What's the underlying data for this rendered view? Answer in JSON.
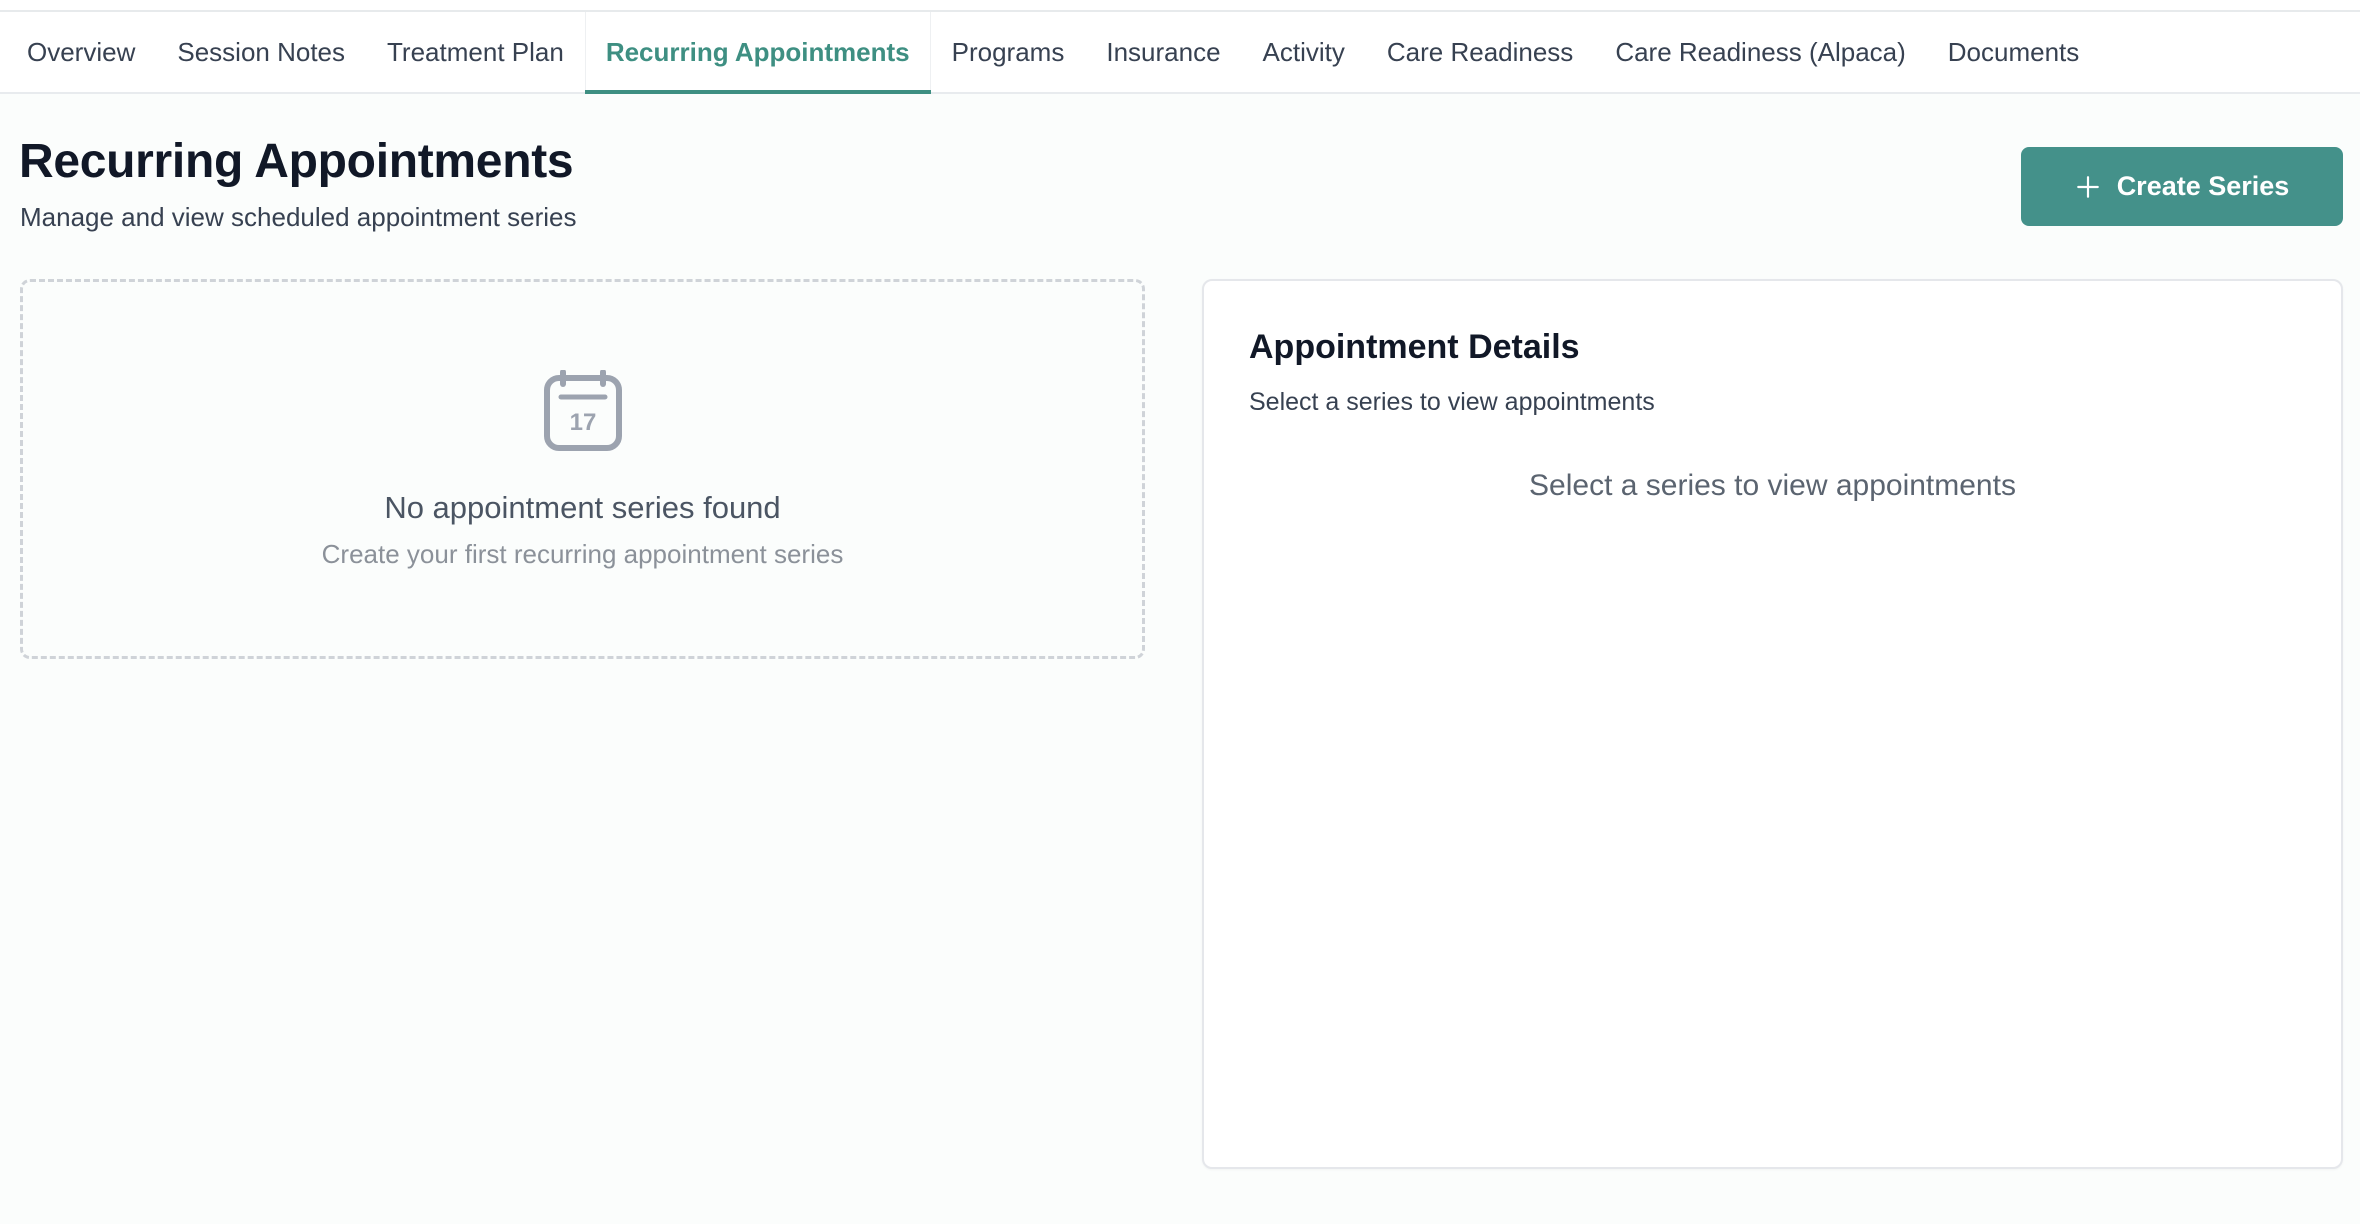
{
  "tabs": [
    {
      "label": "Overview"
    },
    {
      "label": "Session Notes"
    },
    {
      "label": "Treatment Plan"
    },
    {
      "label": "Recurring Appointments",
      "active": true
    },
    {
      "label": "Programs"
    },
    {
      "label": "Insurance"
    },
    {
      "label": "Activity"
    },
    {
      "label": "Care Readiness"
    },
    {
      "label": "Care Readiness (Alpaca)"
    },
    {
      "label": "Documents"
    }
  ],
  "page": {
    "title": "Recurring Appointments",
    "subtitle": "Manage and view scheduled appointment series"
  },
  "create_button": {
    "label": "Create Series",
    "icon": "plus-icon"
  },
  "series_panel": {
    "icon": "calendar-icon",
    "calendar_day": "17",
    "empty_title": "No appointment series found",
    "empty_subtitle": "Create your first recurring appointment series"
  },
  "details_panel": {
    "title": "Appointment Details",
    "subtitle": "Select a series to view appointments",
    "empty_message": "Select a series to view appointments"
  },
  "colors": {
    "accent": "#3e8f82",
    "button": "#44918a",
    "background": "#fbfdfc"
  }
}
